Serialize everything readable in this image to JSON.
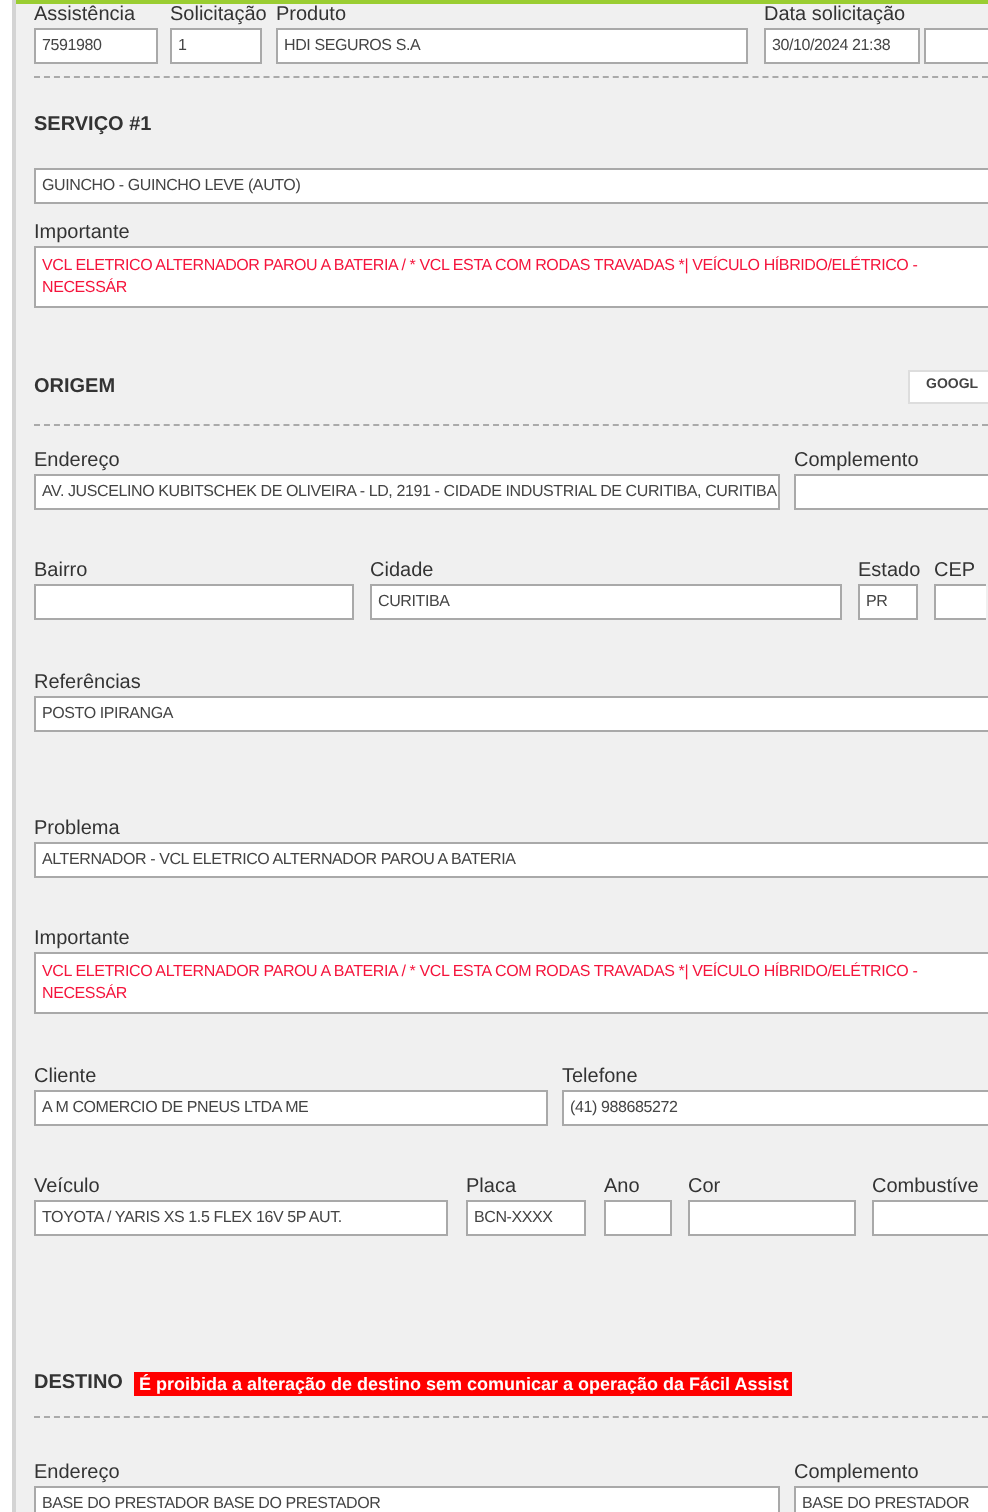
{
  "header_fields": [
    {
      "label": "Assistência",
      "value": "7591980"
    },
    {
      "label": "Solicitação",
      "value": "1"
    },
    {
      "label": "Produto",
      "value": "HDI SEGUROS S.A"
    },
    {
      "label": "Data solicitação",
      "value": "30/10/2024 21:38"
    }
  ],
  "servico": {
    "title": "SERVIÇO #1",
    "service": "GUINCHO - GUINCHO LEVE (AUTO)",
    "important_label": "Importante",
    "important": "VCL ELETRICO ALTERNADOR PAROU A BATERIA / * VCL ESTA COM RODAS TRAVADAS *| VEÍCULO HÍBRIDO/ELÉTRICO - NECESSÁR"
  },
  "origem": {
    "title": "ORIGEM",
    "map_button": "GOOGL",
    "address": [
      {
        "label": "Endereço",
        "value": "AV. JUSCELINO KUBITSCHEK DE OLIVEIRA - LD, 2191 - CIDADE INDUSTRIAL DE CURITIBA, CURITIBA"
      },
      {
        "label": "Complemento"
      }
    ],
    "locality": [
      {
        "label": "Bairro"
      },
      {
        "label": "Cidade",
        "value": "CURITIBA"
      },
      {
        "label": "Estado",
        "value": "PR"
      },
      {
        "label": "CEP"
      }
    ],
    "references": {
      "label": "Referências",
      "value": "POSTO IPIRANGA"
    }
  },
  "problema": {
    "label": "Problema",
    "value": "ALTERNADOR - VCL ELETRICO ALTERNADOR PAROU A BATERIA",
    "important_label": "Importante",
    "important": "VCL ELETRICO ALTERNADOR PAROU A BATERIA / * VCL ESTA COM RODAS TRAVADAS *| VEÍCULO HÍBRIDO/ELÉTRICO - NECESSÁR"
  },
  "cliente": [
    {
      "label": "Cliente",
      "value": "A M COMERCIO DE PNEUS LTDA ME"
    },
    {
      "label": "Telefone",
      "value": "(41) 988685272"
    }
  ],
  "veiculo": [
    {
      "label": "Veículo",
      "value": "TOYOTA / YARIS XS 1.5 FLEX 16V 5P AUT."
    },
    {
      "label": "Placa",
      "value": "BCN-XXXX"
    },
    {
      "label": "Ano"
    },
    {
      "label": "Cor"
    },
    {
      "label": "Combustíve"
    }
  ],
  "destino": {
    "title": "DESTINO",
    "warning": "É proibida a alteração de destino sem comunicar a operação da Fácil Assist",
    "address": [
      {
        "label": "Endereço",
        "value": "BASE DO PRESTADOR BASE DO PRESTADOR"
      },
      {
        "label": "Complemento",
        "value": "BASE DO PRESTADOR"
      }
    ]
  }
}
